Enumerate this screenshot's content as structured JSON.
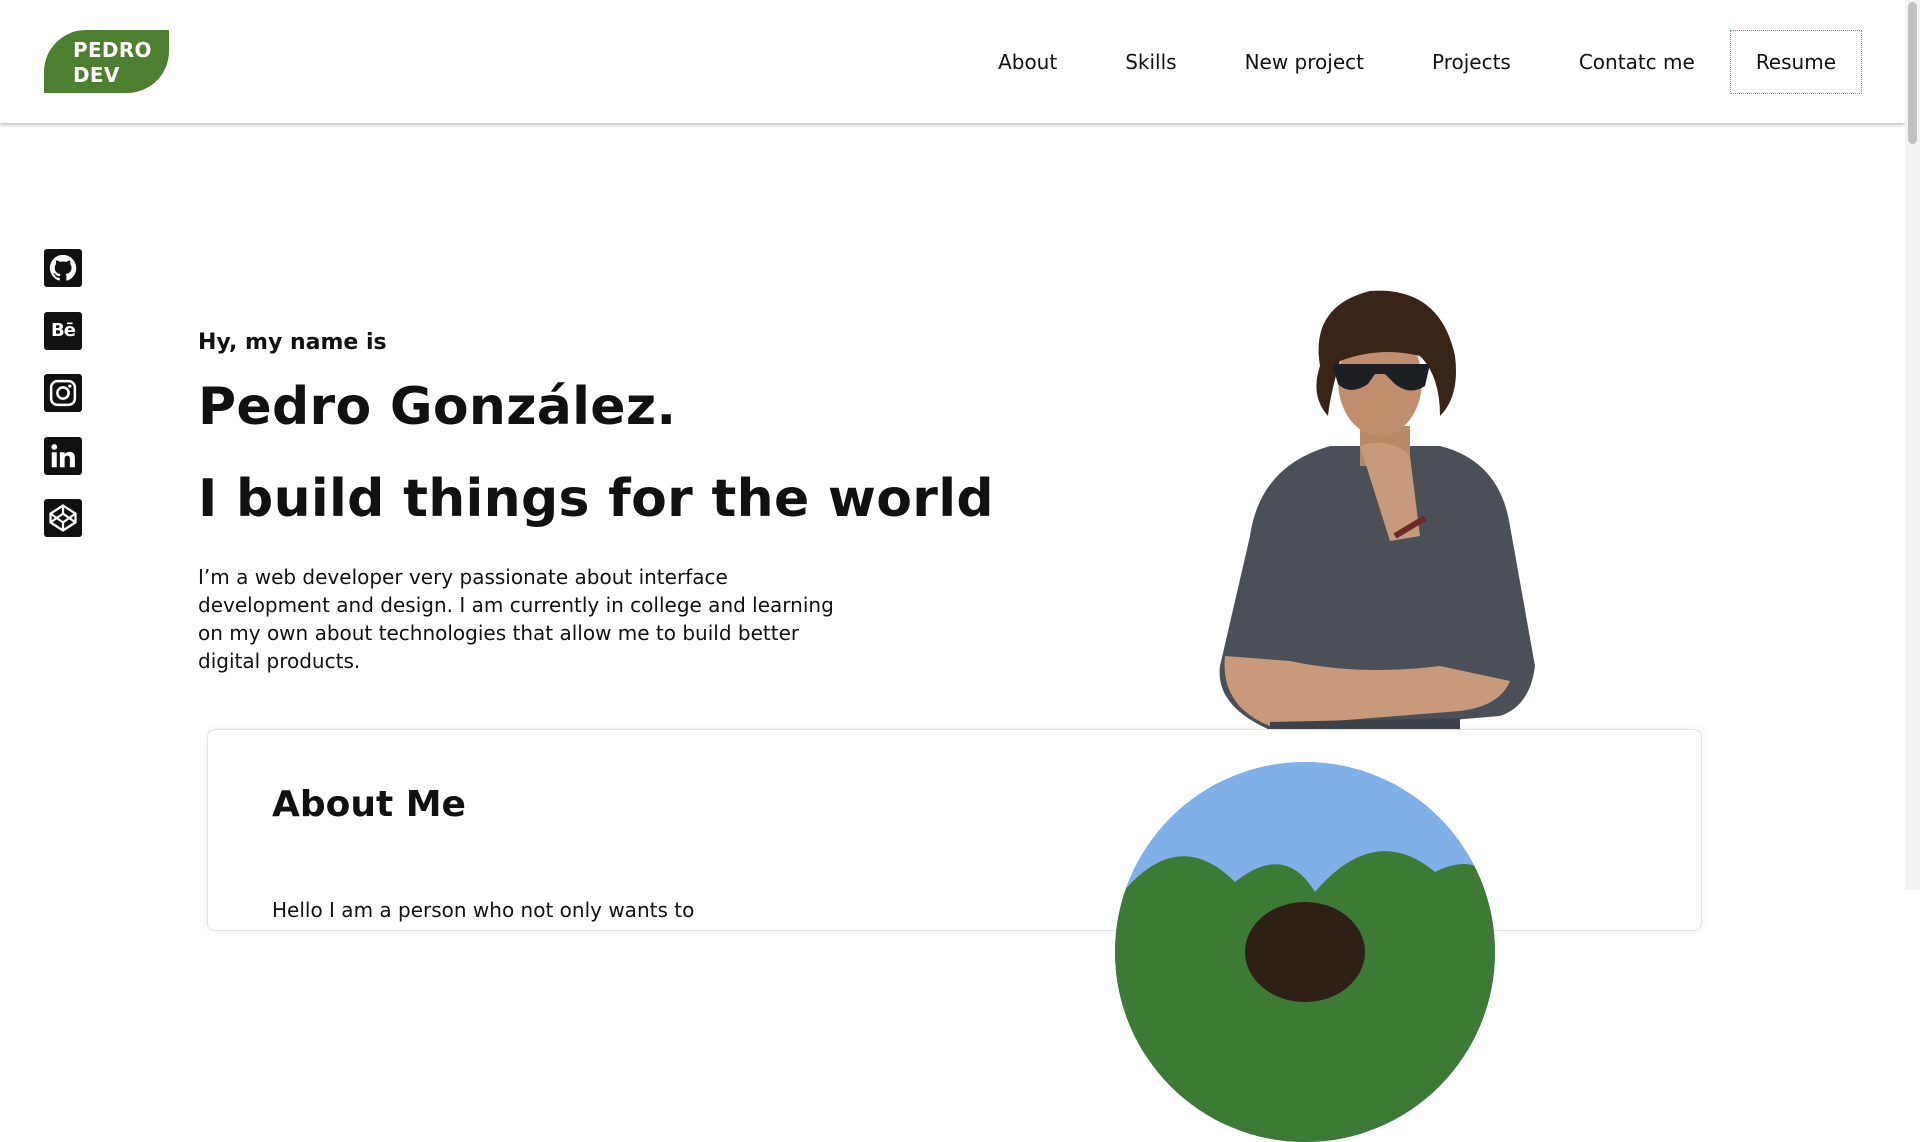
{
  "logo": {
    "line1": "PEDRO",
    "line2": "DEV"
  },
  "nav": {
    "items": [
      "About",
      "Skills",
      "New project",
      "Projects",
      "Contatc me"
    ],
    "resume_label": "Resume"
  },
  "social": [
    "github-icon",
    "behance-icon",
    "instagram-icon",
    "linkedin-icon",
    "codepen-icon"
  ],
  "social_behance_text": "Bē",
  "hero": {
    "greeting": "Hy, my name is",
    "name": "Pedro González.",
    "tagline": "I build things for the world",
    "intro": "I’m a web developer very passionate about interface development and design. I am currently in college and learning on my own about technologies that allow me to build better digital products."
  },
  "about": {
    "title": "About Me",
    "text_partial": "Hello I am a person who not only wants to"
  },
  "colors": {
    "brand": "#4c7f2f",
    "focus_outline": "#3aa2d4",
    "text": "#111111"
  }
}
